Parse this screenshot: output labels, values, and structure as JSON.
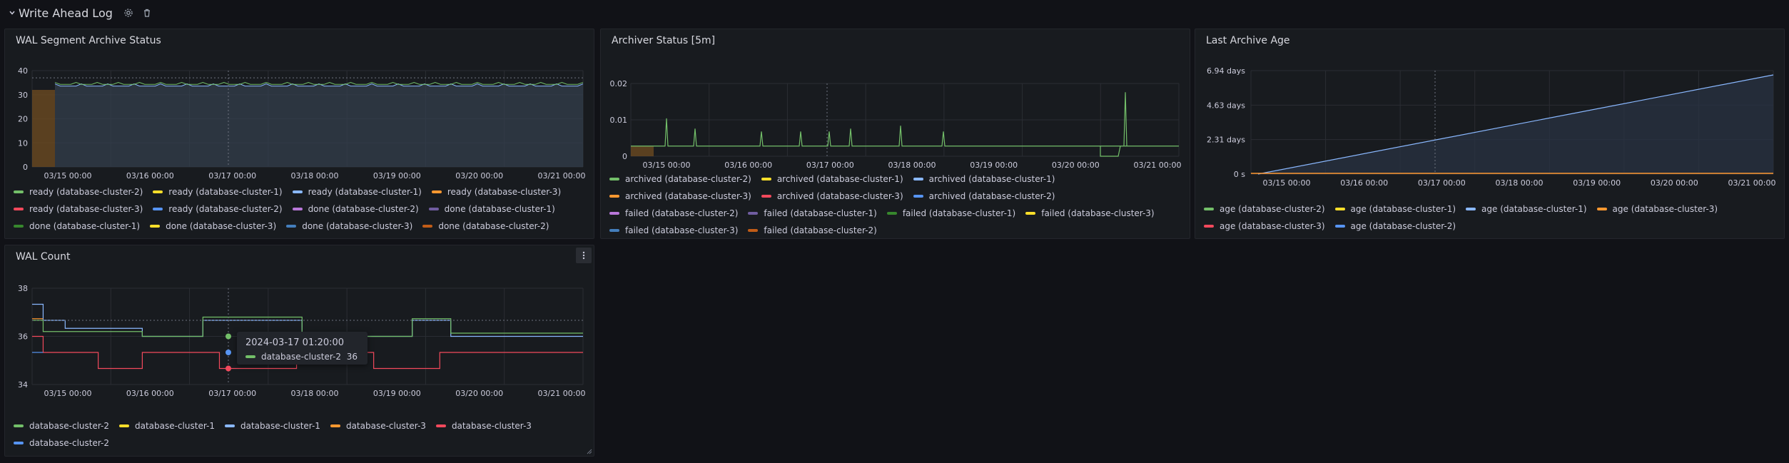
{
  "row": {
    "title": "Write Ahead Log"
  },
  "panels": {
    "p1": {
      "title": "WAL Segment Archive Status",
      "y_ticks": [
        "40",
        "30",
        "20",
        "10",
        "0"
      ],
      "x_ticks": [
        "03/15 00:00",
        "03/16 00:00",
        "03/17 00:00",
        "03/18 00:00",
        "03/19 00:00",
        "03/20 00:00",
        "03/21 00:00"
      ],
      "legend": [
        {
          "label": "ready (database-cluster-2)",
          "color": "#73bf69"
        },
        {
          "label": "ready (database-cluster-1)",
          "color": "#fade2a"
        },
        {
          "label": "ready (database-cluster-1)",
          "color": "#8ab8ff"
        },
        {
          "label": "ready (database-cluster-3)",
          "color": "#ff9830"
        },
        {
          "label": "ready (database-cluster-3)",
          "color": "#f2495c"
        },
        {
          "label": "ready (database-cluster-2)",
          "color": "#5794f2"
        },
        {
          "label": "done (database-cluster-2)",
          "color": "#b877d9"
        },
        {
          "label": "done (database-cluster-1)",
          "color": "#705da0"
        },
        {
          "label": "done (database-cluster-1)",
          "color": "#37872d"
        },
        {
          "label": "done (database-cluster-3)",
          "color": "#fade2a"
        },
        {
          "label": "done (database-cluster-3)",
          "color": "#447ebc"
        },
        {
          "label": "done (database-cluster-2)",
          "color": "#c15c17"
        }
      ]
    },
    "p2": {
      "title": "Archiver Status [5m]",
      "y_ticks": [
        "0.02",
        "0.01",
        "0"
      ],
      "x_ticks": [
        "03/15 00:00",
        "03/16 00:00",
        "03/17 00:00",
        "03/18 00:00",
        "03/19 00:00",
        "03/20 00:00",
        "03/21 00:00"
      ],
      "legend": [
        {
          "label": "archived (database-cluster-2)",
          "color": "#73bf69"
        },
        {
          "label": "archived (database-cluster-1)",
          "color": "#fade2a"
        },
        {
          "label": "archived (database-cluster-1)",
          "color": "#8ab8ff"
        },
        {
          "label": "archived (database-cluster-3)",
          "color": "#ff9830"
        },
        {
          "label": "archived (database-cluster-3)",
          "color": "#f2495c"
        },
        {
          "label": "archived (database-cluster-2)",
          "color": "#5794f2"
        },
        {
          "label": "failed (database-cluster-2)",
          "color": "#b877d9"
        },
        {
          "label": "failed (database-cluster-1)",
          "color": "#705da0"
        },
        {
          "label": "failed (database-cluster-1)",
          "color": "#37872d"
        },
        {
          "label": "failed (database-cluster-3)",
          "color": "#fade2a"
        },
        {
          "label": "failed (database-cluster-3)",
          "color": "#447ebc"
        },
        {
          "label": "failed (database-cluster-2)",
          "color": "#c15c17"
        }
      ]
    },
    "p3": {
      "title": "Last Archive Age",
      "y_ticks": [
        "6.94 days",
        "4.63 days",
        "2.31 days",
        "0 s"
      ],
      "x_ticks": [
        "03/15 00:00",
        "03/16 00:00",
        "03/17 00:00",
        "03/18 00:00",
        "03/19 00:00",
        "03/20 00:00",
        "03/21 00:00"
      ],
      "legend": [
        {
          "label": "age (database-cluster-2)",
          "color": "#73bf69"
        },
        {
          "label": "age (database-cluster-1)",
          "color": "#fade2a"
        },
        {
          "label": "age (database-cluster-1)",
          "color": "#8ab8ff"
        },
        {
          "label": "age (database-cluster-3)",
          "color": "#ff9830"
        },
        {
          "label": "age (database-cluster-3)",
          "color": "#f2495c"
        },
        {
          "label": "age (database-cluster-2)",
          "color": "#5794f2"
        }
      ]
    },
    "p4": {
      "title": "WAL Count",
      "y_ticks": [
        "38",
        "36",
        "34"
      ],
      "x_ticks": [
        "03/15 00:00",
        "03/16 00:00",
        "03/17 00:00",
        "03/18 00:00",
        "03/19 00:00",
        "03/20 00:00",
        "03/21 00:00"
      ],
      "legend": [
        {
          "label": "database-cluster-2",
          "color": "#73bf69"
        },
        {
          "label": "database-cluster-1",
          "color": "#fade2a"
        },
        {
          "label": "database-cluster-1",
          "color": "#8ab8ff"
        },
        {
          "label": "database-cluster-3",
          "color": "#ff9830"
        },
        {
          "label": "database-cluster-3",
          "color": "#f2495c"
        },
        {
          "label": "database-cluster-2",
          "color": "#5794f2"
        }
      ],
      "tooltip": {
        "time": "2024-03-17 01:20:00",
        "series": "database-cluster-2",
        "value": "36",
        "color": "#73bf69"
      }
    }
  },
  "chart_data": [
    {
      "type": "area",
      "title": "WAL Segment Archive Status",
      "x": [
        "03/15 00:00",
        "03/16 00:00",
        "03/17 00:00",
        "03/18 00:00",
        "03/19 00:00",
        "03/20 00:00",
        "03/21 00:00"
      ],
      "ylim": [
        0,
        40
      ],
      "series": [
        {
          "name": "ready (database-cluster-2)",
          "values": [
            34,
            35,
            34,
            34,
            34,
            34,
            34
          ]
        },
        {
          "name": "ready (database-cluster-1)",
          "values": [
            33,
            33,
            33,
            33,
            33,
            33,
            33
          ]
        },
        {
          "name": "done (database-cluster-2)",
          "values": [
            32,
            0,
            0,
            0,
            0,
            0,
            0
          ]
        }
      ]
    },
    {
      "type": "line",
      "title": "Archiver Status [5m]",
      "x": [
        "03/15 00:00",
        "03/16 00:00",
        "03/17 00:00",
        "03/18 00:00",
        "03/19 00:00",
        "03/20 00:00",
        "03/21 00:00"
      ],
      "ylim": [
        0,
        0.025
      ],
      "series": [
        {
          "name": "archived (database-cluster-2)",
          "values": [
            0.0035,
            0.0035,
            0.0035,
            0.0035,
            0.0035,
            0.0035,
            0.0035
          ]
        }
      ]
    },
    {
      "type": "area",
      "title": "Last Archive Age",
      "x": [
        "03/15 00:00",
        "03/16 00:00",
        "03/17 00:00",
        "03/18 00:00",
        "03/19 00:00",
        "03/20 00:00",
        "03/21 00:00"
      ],
      "y_unit": "days",
      "ylim": [
        0,
        8
      ],
      "series": [
        {
          "name": "age (database-cluster-1)",
          "values": [
            0.3,
            1.5,
            2.6,
            3.7,
            4.8,
            5.9,
            7.0
          ]
        }
      ]
    },
    {
      "type": "line",
      "title": "WAL Count",
      "x": [
        "03/15 00:00",
        "03/16 00:00",
        "03/17 00:00",
        "03/18 00:00",
        "03/19 00:00",
        "03/20 00:00",
        "03/21 00:00"
      ],
      "ylim": [
        33,
        39
      ],
      "series": [
        {
          "name": "database-cluster-2",
          "values": [
            37,
            36,
            36,
            36,
            37,
            37,
            36
          ]
        },
        {
          "name": "database-cluster-1",
          "values": [
            37,
            37,
            37,
            37,
            37,
            37,
            37
          ]
        },
        {
          "name": "database-cluster-1",
          "values": [
            38,
            36,
            36,
            36,
            36,
            36,
            36
          ]
        },
        {
          "name": "database-cluster-3",
          "values": [
            36,
            35,
            35,
            35,
            35,
            35,
            35
          ]
        },
        {
          "name": "database-cluster-3",
          "values": [
            36,
            35,
            35,
            35,
            35,
            35,
            35
          ]
        },
        {
          "name": "database-cluster-2",
          "values": [
            35,
            36,
            36,
            35,
            35,
            35,
            35
          ]
        }
      ]
    }
  ]
}
